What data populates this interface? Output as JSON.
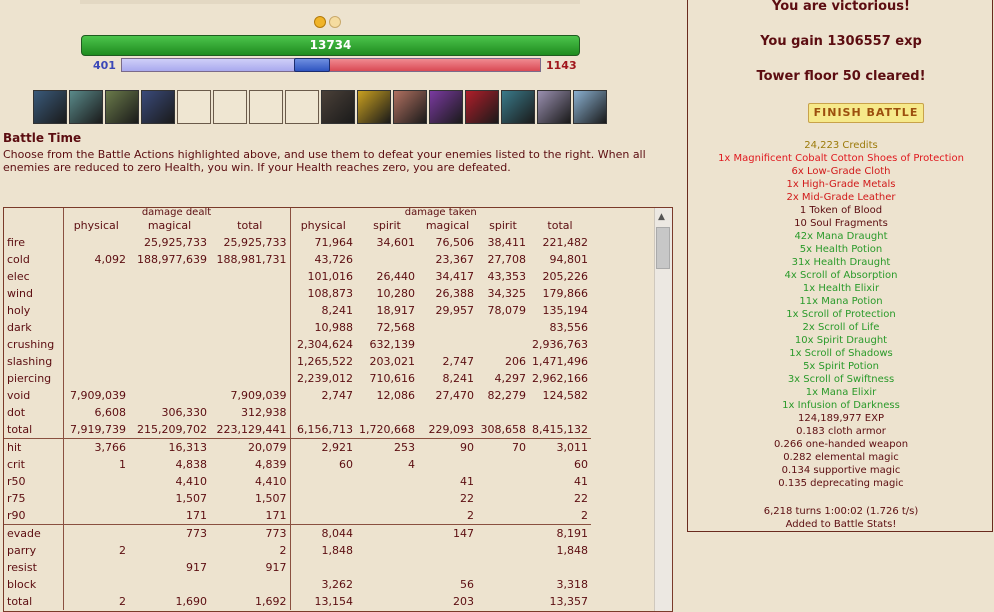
{
  "round_dots": [
    {
      "state": "active"
    },
    {
      "state": "inactive"
    }
  ],
  "hp": {
    "value": "13734",
    "fill_fraction": 1.0
  },
  "mp": {
    "left_value": "401",
    "right_value": "1143",
    "left_fraction": 0.42
  },
  "colors": {
    "hp_green": "#1f8c1f",
    "mp_blue": "#3b48b8",
    "mp_red": "#a0161c",
    "text_dark": "#5c0d11",
    "credits": "#9c7a0a",
    "legendary": "#e0181e",
    "rare": "#d11a1a",
    "uncommon": "#2a9a2a",
    "normal": "#5c0d11"
  },
  "skill_slots": [
    {
      "icon": "skill-icon-1",
      "filled": true,
      "color": "#3a5a7a"
    },
    {
      "icon": "skill-icon-2",
      "filled": true,
      "color": "#5a8a8a"
    },
    {
      "icon": "skill-icon-3",
      "filled": true,
      "color": "#6a7a4a"
    },
    {
      "icon": "skill-icon-4",
      "filled": true,
      "color": "#3a4a7a"
    },
    {
      "icon": "empty-slot-icon",
      "filled": false,
      "color": ""
    },
    {
      "icon": "empty-slot-icon",
      "filled": false,
      "color": ""
    },
    {
      "icon": "empty-slot-icon",
      "filled": false,
      "color": ""
    },
    {
      "icon": "empty-slot-icon",
      "filled": false,
      "color": ""
    },
    {
      "icon": "skill-icon-5",
      "filled": true,
      "color": "#4a4038"
    },
    {
      "icon": "skill-icon-6",
      "filled": true,
      "color": "#c9a020"
    },
    {
      "icon": "skill-icon-7",
      "filled": true,
      "color": "#b07060"
    },
    {
      "icon": "skill-icon-8",
      "filled": true,
      "color": "#7a3aa0"
    },
    {
      "icon": "skill-icon-9",
      "filled": true,
      "color": "#b01e2a"
    },
    {
      "icon": "skill-icon-10",
      "filled": true,
      "color": "#3a7a8a"
    },
    {
      "icon": "skill-icon-11",
      "filled": true,
      "color": "#9a90b0"
    },
    {
      "icon": "skill-icon-12",
      "filled": true,
      "color": "#8ab0d0"
    }
  ],
  "battle": {
    "title": "Battle Time",
    "description": "Choose from the Battle Actions highlighted above, and use them to defeat your enemies listed to the right. When all enemies are reduced to zero Health, you win. If your Health reaches zero, you are defeated."
  },
  "stats_table": {
    "group_headers": {
      "dealt": "damage dealt",
      "taken": "damage taken"
    },
    "sub_headers": [
      "",
      "physical",
      "magical",
      "total",
      "physical",
      "spirit",
      "magical",
      "spirit",
      "total"
    ],
    "rows": [
      {
        "label": "fire",
        "cells": [
          "",
          "25,925,733",
          "25,925,733",
          "71,964",
          "34,601",
          "76,506",
          "38,411",
          "221,482"
        ]
      },
      {
        "label": "cold",
        "cells": [
          "4,092",
          "188,977,639",
          "188,981,731",
          "43,726",
          "",
          "23,367",
          "27,708",
          "94,801"
        ]
      },
      {
        "label": "elec",
        "cells": [
          "",
          "",
          "",
          "101,016",
          "26,440",
          "34,417",
          "43,353",
          "205,226"
        ]
      },
      {
        "label": "wind",
        "cells": [
          "",
          "",
          "",
          "108,873",
          "10,280",
          "26,388",
          "34,325",
          "179,866"
        ]
      },
      {
        "label": "holy",
        "cells": [
          "",
          "",
          "",
          "8,241",
          "18,917",
          "29,957",
          "78,079",
          "135,194"
        ]
      },
      {
        "label": "dark",
        "cells": [
          "",
          "",
          "",
          "10,988",
          "72,568",
          "",
          "",
          "83,556"
        ]
      },
      {
        "label": "crushing",
        "cells": [
          "",
          "",
          "",
          "2,304,624",
          "632,139",
          "",
          "",
          "2,936,763"
        ]
      },
      {
        "label": "slashing",
        "cells": [
          "",
          "",
          "",
          "1,265,522",
          "203,021",
          "2,747",
          "206",
          "1,471,496"
        ]
      },
      {
        "label": "piercing",
        "cells": [
          "",
          "",
          "",
          "2,239,012",
          "710,616",
          "8,241",
          "4,297",
          "2,962,166"
        ]
      },
      {
        "label": "void",
        "cells": [
          "7,909,039",
          "",
          "7,909,039",
          "2,747",
          "12,086",
          "27,470",
          "82,279",
          "124,582"
        ]
      },
      {
        "label": "dot",
        "cells": [
          "6,608",
          "306,330",
          "312,938",
          "",
          "",
          "",
          "",
          ""
        ]
      },
      {
        "label": "total",
        "cells": [
          "7,919,739",
          "215,209,702",
          "223,129,441",
          "6,156,713",
          "1,720,668",
          "229,093",
          "308,658",
          "8,415,132"
        ]
      },
      {
        "label": "hit",
        "sep": true,
        "cells": [
          "3,766",
          "16,313",
          "20,079",
          "2,921",
          "253",
          "90",
          "70",
          "3,011"
        ]
      },
      {
        "label": "crit",
        "cells": [
          "1",
          "4,838",
          "4,839",
          "60",
          "4",
          "",
          "",
          "60"
        ]
      },
      {
        "label": "r50",
        "cells": [
          "",
          "4,410",
          "4,410",
          "",
          "",
          "41",
          "",
          "41"
        ]
      },
      {
        "label": "r75",
        "cells": [
          "",
          "1,507",
          "1,507",
          "",
          "",
          "22",
          "",
          "22"
        ]
      },
      {
        "label": "r90",
        "cells": [
          "",
          "171",
          "171",
          "",
          "",
          "2",
          "",
          "2"
        ]
      },
      {
        "label": "evade",
        "sep": true,
        "cells": [
          "",
          "773",
          "773",
          "8,044",
          "",
          "147",
          "",
          "8,191"
        ]
      },
      {
        "label": "parry",
        "cells": [
          "2",
          "",
          "2",
          "1,848",
          "",
          "",
          "",
          "1,848"
        ]
      },
      {
        "label": "resist",
        "cells": [
          "",
          "917",
          "917",
          "",
          "",
          "",
          "",
          ""
        ]
      },
      {
        "label": "block",
        "cells": [
          "",
          "",
          "",
          "3,262",
          "",
          "56",
          "",
          "3,318"
        ]
      },
      {
        "label": "total",
        "cells": [
          "2",
          "1,690",
          "1,692",
          "13,154",
          "",
          "203",
          "",
          "13,357"
        ]
      }
    ]
  },
  "results": {
    "victory": "You are victorious!",
    "exp_gain": "You gain 1306557 exp",
    "floor_cleared": "Tower floor 50 cleared!",
    "finish_button": "FINISH BATTLE",
    "drops": [
      {
        "text": "24,223 Credits",
        "color": "#9c7a0a"
      },
      {
        "text": "1x Magnificent Cobalt Cotton Shoes of Protection",
        "color": "#e0181e"
      },
      {
        "text": "6x Low-Grade Cloth",
        "color": "#d11a1a"
      },
      {
        "text": "1x High-Grade Metals",
        "color": "#d11a1a"
      },
      {
        "text": "2x Mid-Grade Leather",
        "color": "#d11a1a"
      },
      {
        "text": "1 Token of Blood",
        "color": "#5c0d11"
      },
      {
        "text": "10 Soul Fragments",
        "color": "#5c0d11"
      },
      {
        "text": "42x Mana Draught",
        "color": "#2a9a2a"
      },
      {
        "text": "5x Health Potion",
        "color": "#2a9a2a"
      },
      {
        "text": "31x Health Draught",
        "color": "#2a9a2a"
      },
      {
        "text": "4x Scroll of Absorption",
        "color": "#2a9a2a"
      },
      {
        "text": "1x Health Elixir",
        "color": "#2a9a2a"
      },
      {
        "text": "11x Mana Potion",
        "color": "#2a9a2a"
      },
      {
        "text": "1x Scroll of Protection",
        "color": "#2a9a2a"
      },
      {
        "text": "2x Scroll of Life",
        "color": "#2a9a2a"
      },
      {
        "text": "10x Spirit Draught",
        "color": "#2a9a2a"
      },
      {
        "text": "1x Scroll of Shadows",
        "color": "#2a9a2a"
      },
      {
        "text": "5x Spirit Potion",
        "color": "#2a9a2a"
      },
      {
        "text": "3x Scroll of Swiftness",
        "color": "#2a9a2a"
      },
      {
        "text": "1x Mana Elixir",
        "color": "#2a9a2a"
      },
      {
        "text": "1x Infusion of Darkness",
        "color": "#2a9a2a"
      },
      {
        "text": "124,189,977 EXP",
        "color": "#5c0d11"
      },
      {
        "text": "0.183 cloth armor",
        "color": "#5c0d11"
      },
      {
        "text": "0.266 one-handed weapon",
        "color": "#5c0d11"
      },
      {
        "text": "0.282 elemental magic",
        "color": "#5c0d11"
      },
      {
        "text": "0.134 supportive magic",
        "color": "#5c0d11"
      },
      {
        "text": "0.135 deprecating magic",
        "color": "#5c0d11"
      }
    ],
    "turns_line": "6,218 turns 1:00:02 (1.726 t/s)",
    "added_line": "Added to Battle Stats!"
  }
}
